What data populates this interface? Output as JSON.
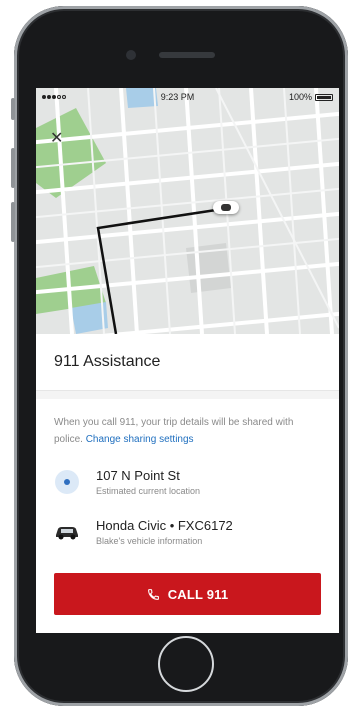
{
  "status_bar": {
    "time": "9:23 PM",
    "battery": "100%"
  },
  "sheet": {
    "title": "911 Assistance",
    "notice_text": "When you call 911, your trip details will be shared with police.",
    "notice_link": "Change sharing settings",
    "location": {
      "main": "107 N Point St",
      "sub": "Estimated current location",
      "icon": "location-dot-icon"
    },
    "vehicle": {
      "main": "Honda Civic • FXC6172",
      "sub": "Blake's vehicle information",
      "icon": "car-icon"
    },
    "call_button": {
      "label": "CALL 911",
      "icon": "phone-icon"
    }
  },
  "colors": {
    "accent": "#c9171d",
    "link": "#1f6fbf",
    "map_bg": "#e3e5e4",
    "park": "#9fcf8f",
    "water": "#a8cde8"
  }
}
